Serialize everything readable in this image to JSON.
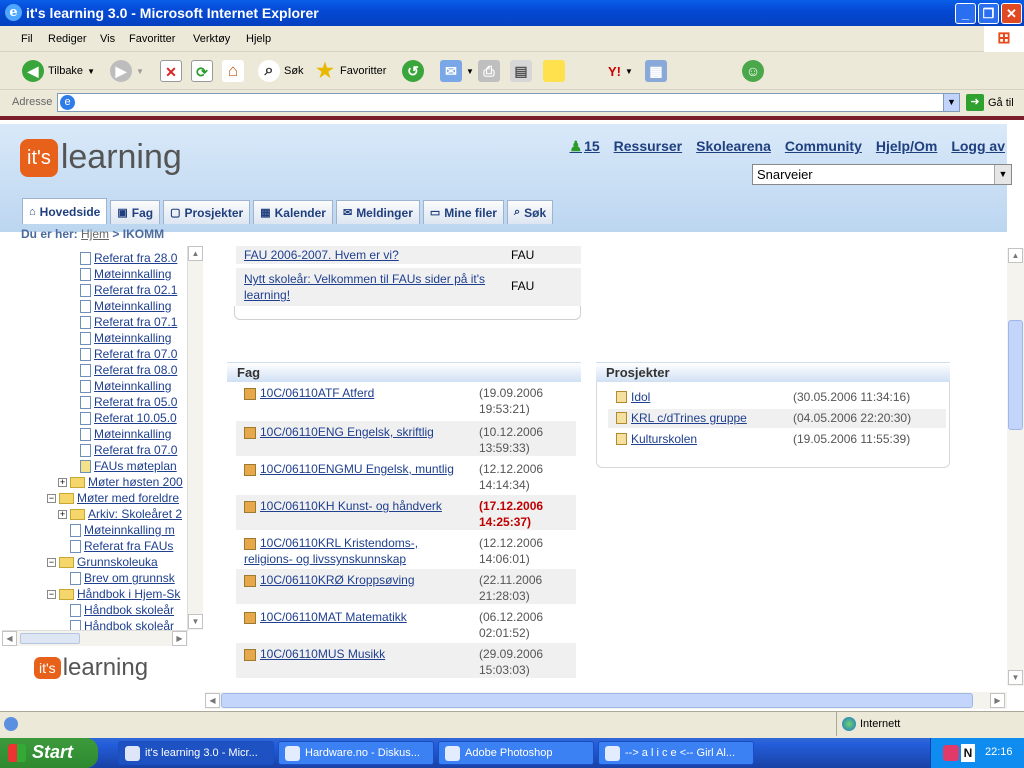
{
  "window": {
    "title": "it's learning 3.0 - Microsoft Internet Explorer"
  },
  "menu": [
    "Fil",
    "Rediger",
    "Vis",
    "Favoritter",
    "Verktøy",
    "Hjelp"
  ],
  "toolbar": {
    "back": "Tilbake",
    "search": "Søk",
    "favorites": "Favoritter"
  },
  "address": {
    "label": "Adresse",
    "go": "Gå til",
    "value": ""
  },
  "site": {
    "logo_its": "it's",
    "logo_learning": "learning",
    "online_count": "15",
    "toplinks": [
      "Ressurser",
      "Skolearena",
      "Community",
      "Hjelp/Om",
      "Logg av"
    ],
    "shortcut": "Snarveier",
    "tabs": [
      "Hovedside",
      "Fag",
      "Prosjekter",
      "Kalender",
      "Meldinger",
      "Mine filer",
      "Søk"
    ],
    "breadcrumb": {
      "prefix": "Du er her:",
      "home": "Hjem",
      "sep": ">",
      "current": "IKOMM"
    }
  },
  "tree": [
    {
      "type": "doc",
      "label": "Referat fra 28.0"
    },
    {
      "type": "doc",
      "label": "Møteinnkalling"
    },
    {
      "type": "doc",
      "label": "Referat fra 02.1"
    },
    {
      "type": "doc",
      "label": "Møteinnkalling"
    },
    {
      "type": "doc",
      "label": "Referat fra 07.1"
    },
    {
      "type": "doc",
      "label": "Møteinnkalling"
    },
    {
      "type": "doc",
      "label": "Referat fra 07.0"
    },
    {
      "type": "doc",
      "label": "Referat fra 08.0"
    },
    {
      "type": "doc",
      "label": "Møteinnkalling"
    },
    {
      "type": "doc",
      "label": "Referat fra 05.0"
    },
    {
      "type": "doc",
      "label": "Referat 10.05.0"
    },
    {
      "type": "doc",
      "label": "Møteinnkalling"
    },
    {
      "type": "doc",
      "label": "Referat fra 07.0"
    },
    {
      "type": "doc2",
      "label": "FAUs møteplan"
    },
    {
      "type": "folder+",
      "label": "Møter høsten 200"
    },
    {
      "type": "folder-",
      "label": "Møter med foreldre"
    },
    {
      "type": "folder+2",
      "label": "Arkiv: Skoleåret 2"
    },
    {
      "type": "doc3",
      "label": "Møteinnkalling m"
    },
    {
      "type": "doc3",
      "label": "Referat fra FAUs"
    },
    {
      "type": "folder-",
      "label": "Grunnskoleuka"
    },
    {
      "type": "doc3",
      "label": "Brev om grunnsk"
    },
    {
      "type": "folder-",
      "label": "Håndbok i Hjem-Sk"
    },
    {
      "type": "doc3",
      "label": "Håndbok skoleår"
    },
    {
      "type": "doc3",
      "label": "Håndbok skoleår"
    }
  ],
  "fau_rows": [
    {
      "title": "FAU 2006-2007. Hvem er vi?",
      "owner": "FAU"
    },
    {
      "title": "Nytt skoleår: Velkommen til FAUs sider på it's learning!",
      "owner": "FAU"
    }
  ],
  "fag": {
    "heading": "Fag",
    "items": [
      {
        "name": "10C/06110ATF Atferd",
        "date": "(19.09.2006",
        "time": "19:53:21)",
        "red": false
      },
      {
        "name": "10C/06110ENG Engelsk, skriftlig",
        "date": "(10.12.2006",
        "time": "13:59:33)",
        "red": false
      },
      {
        "name": "10C/06110ENGMU Engelsk, muntlig",
        "date": "(12.12.2006",
        "time": "14:14:34)",
        "red": false
      },
      {
        "name": "10C/06110KH Kunst- og håndverk",
        "date": "(17.12.2006",
        "time": "14:25:37)",
        "red": true
      },
      {
        "name": "10C/06110KRL Kristendoms-, religions- og livssynskunnskap",
        "date": "(12.12.2006",
        "time": "14:06:01)",
        "red": false
      },
      {
        "name": "10C/06110KRØ Kroppsøving",
        "date": "(22.11.2006",
        "time": "21:28:03)",
        "red": false
      },
      {
        "name": "10C/06110MAT Matematikk",
        "date": "(06.12.2006",
        "time": "02:01:52)",
        "red": false
      },
      {
        "name": "10C/06110MUS Musikk",
        "date": "(29.09.2006",
        "time": "15:03:03)",
        "red": false
      }
    ]
  },
  "prosjekter": {
    "heading": "Prosjekter",
    "items": [
      {
        "name": "Idol",
        "date": "(30.05.2006 11:34:16)"
      },
      {
        "name": "KRL c/dTrines gruppe",
        "date": "(04.05.2006 22:20:30)"
      },
      {
        "name": "Kulturskolen",
        "date": "(19.05.2006 11:55:39)"
      }
    ]
  },
  "status": {
    "zone": "Internett"
  },
  "taskbar": {
    "start": "Start",
    "tasks": [
      "it's learning 3.0 - Micr...",
      "Hardware.no - Diskus...",
      "Adobe Photoshop",
      "--> a l i c e <-- Girl Al..."
    ],
    "clock": "22:16"
  },
  "colors": {
    "accent": "#e8611a",
    "link": "#1f3f8f",
    "titlebar": "#0a5ee8",
    "red_date": "#c00000"
  }
}
